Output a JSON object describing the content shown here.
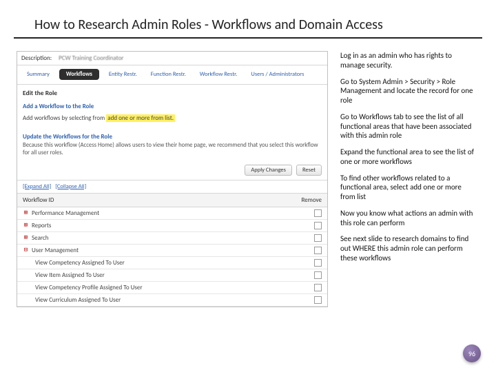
{
  "title": "How to Research Admin Roles - Workflows and Domain Access",
  "app": {
    "descriptionLabel": "Description:",
    "descriptionValue": "PCW Training Coordinator",
    "tabs": {
      "summary": "Summary",
      "workflows": "Workflows",
      "entity": "Entity Restr.",
      "function": "Function Restr.",
      "wrestrict": "Workflow Restr.",
      "users": "Users / Administrators"
    },
    "editRole": "Edit the Role",
    "addWorkflow": "Add a Workflow to the Role",
    "addLinePrefix": "Add workflows by selecting from ",
    "addLineHighlight": "add one or more from list.",
    "updateTitle": "Update the Workflows for the Role",
    "updateNote": "Because this workflow (Access Home) allows users to view their home page, we recommend that you select this workflow for all user roles.",
    "btnApply": "Apply Changes",
    "btnReset": "Reset",
    "linkExpand": "[Expand All]",
    "linkCollapse": "[Collapse All]",
    "thId": "Workflow ID",
    "thRemove": "Remove",
    "rows": {
      "r0": "Performance Management",
      "r1": "Reports",
      "r2": "Search",
      "r3": "User Management",
      "c0": "View Competency Assigned To User",
      "c1": "View Item Assigned To User",
      "c2": "View Competency Profile Assigned To User",
      "c3": "View Curriculum Assigned To User"
    }
  },
  "instructions": {
    "p1": "Log in as an admin who has rights to manage security.",
    "p2": "Go to System Admin > Security > Role Management and locate the record for one role",
    "p3": "Go to Workflows tab to see the list of all functional areas that have been associated with this admin role",
    "p4": "Expand the functional area to see the list of one or more workflows",
    "p5": "To find other workflows related to a functional area, select add one or more from list",
    "p6": "Now you know what actions an admin with this role can perform",
    "p7": "See next slide to research domains to find out WHERE this admin role can perform these workflows"
  },
  "pageNumber": "96"
}
